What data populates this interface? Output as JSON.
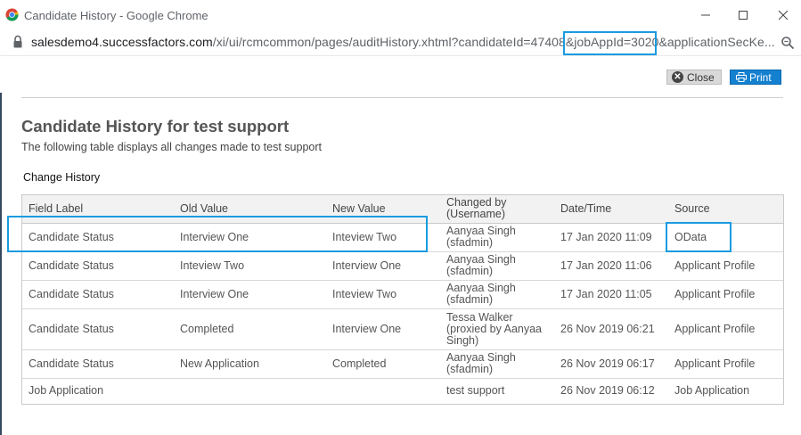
{
  "browser": {
    "window_title": "Candidate History - Google Chrome",
    "url_host": "salesdemo4.successfactors.com",
    "url_path": "/xi/ui/rcmcommon/pages/auditHistory.xhtml?candidateId=47408&jobAppId=3020&applicationSecKe..."
  },
  "toolbar": {
    "close_label": "Close",
    "print_label": "Print"
  },
  "page": {
    "title": "Candidate History for test support",
    "subtitle": "The following table displays all changes made to test support",
    "section_label": "Change History"
  },
  "table": {
    "headers": [
      "Field Label",
      "Old Value",
      "New Value",
      "Changed by (Username)",
      "Date/Time",
      "Source"
    ],
    "rows": [
      [
        "Candidate Status",
        "Interview One",
        "Inteview Two",
        "Aanyaa Singh (sfadmin)",
        "17 Jan 2020 11:09",
        "OData"
      ],
      [
        "Candidate Status",
        "Inteview Two",
        "Interview One",
        "Aanyaa Singh (sfadmin)",
        "17 Jan 2020 11:06",
        "Applicant Profile"
      ],
      [
        "Candidate Status",
        "Interview One",
        "Inteview Two",
        "Aanyaa Singh (sfadmin)",
        "17 Jan 2020 11:05",
        "Applicant Profile"
      ],
      [
        "Candidate Status",
        "Completed",
        "Interview One",
        "Tessa Walker (proxied by Aanyaa Singh)",
        "26 Nov 2019 06:21",
        "Applicant Profile"
      ],
      [
        "Candidate Status",
        "New Application",
        "Completed",
        "Aanyaa Singh (sfadmin)",
        "26 Nov 2019 06:17",
        "Applicant Profile"
      ],
      [
        "Job Application",
        "",
        "",
        "test support",
        "26 Nov 2019 06:12",
        "Job Application"
      ]
    ]
  },
  "colors": {
    "accent": "#1480d0",
    "highlight": "#1a9be0"
  }
}
